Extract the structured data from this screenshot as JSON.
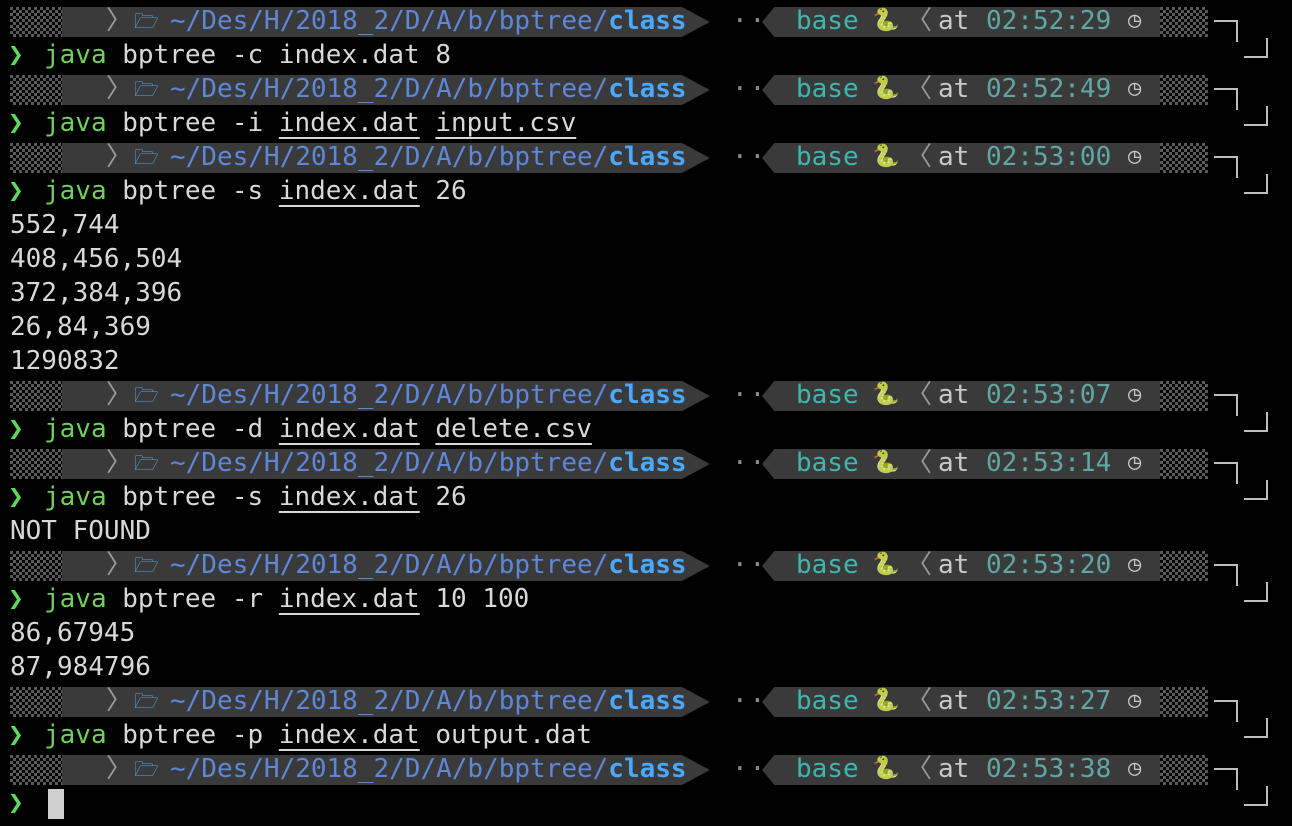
{
  "prompt": {
    "apple_icon": "",
    "chevron_icon": "〉",
    "folder_icon": "🗁",
    "path_dim": "~/Des/H/2018_2/D/A/b/bptree/",
    "path_bold": "class",
    "dots": "··",
    "env": "base",
    "python_icon": "🐍",
    "chevron_left_icon": "〈",
    "at": "at",
    "clock_icon": "◷",
    "prompt_char": "❯"
  },
  "blocks": [
    {
      "time": "02:52:29",
      "cmd": {
        "kw": "java",
        "prog": "bptree",
        "flag": "-c",
        "arg1": "index.dat",
        "arg2": "8"
      },
      "output": []
    },
    {
      "time": "02:52:49",
      "cmd": {
        "kw": "java",
        "prog": "bptree",
        "flag": "-i",
        "arg1": "index.dat",
        "arg2": "input.csv"
      },
      "output": []
    },
    {
      "time": "02:53:00",
      "cmd": {
        "kw": "java",
        "prog": "bptree",
        "flag": "-s",
        "arg1": "index.dat",
        "arg2": "26"
      },
      "output": [
        "552,744",
        "408,456,504",
        "372,384,396",
        "26,84,369",
        "1290832"
      ]
    },
    {
      "time": "02:53:07",
      "cmd": {
        "kw": "java",
        "prog": "bptree",
        "flag": "-d",
        "arg1": "index.dat",
        "arg2": "delete.csv"
      },
      "output": []
    },
    {
      "time": "02:53:14",
      "cmd": {
        "kw": "java",
        "prog": "bptree",
        "flag": "-s",
        "arg1": "index.dat",
        "arg2": "26"
      },
      "output": [
        "NOT FOUND"
      ]
    },
    {
      "time": "02:53:20",
      "cmd": {
        "kw": "java",
        "prog": "bptree",
        "flag": "-r",
        "arg1": "index.dat",
        "arg2": "10 100"
      },
      "output": [
        "86,67945",
        "87,984796"
      ]
    },
    {
      "time": "02:53:27",
      "cmd": {
        "kw": "java",
        "prog": "bptree",
        "flag": "-p",
        "arg1": "index.dat",
        "arg2": "output.dat"
      },
      "output": []
    },
    {
      "time": "02:53:38",
      "cmd": null,
      "output": []
    }
  ]
}
